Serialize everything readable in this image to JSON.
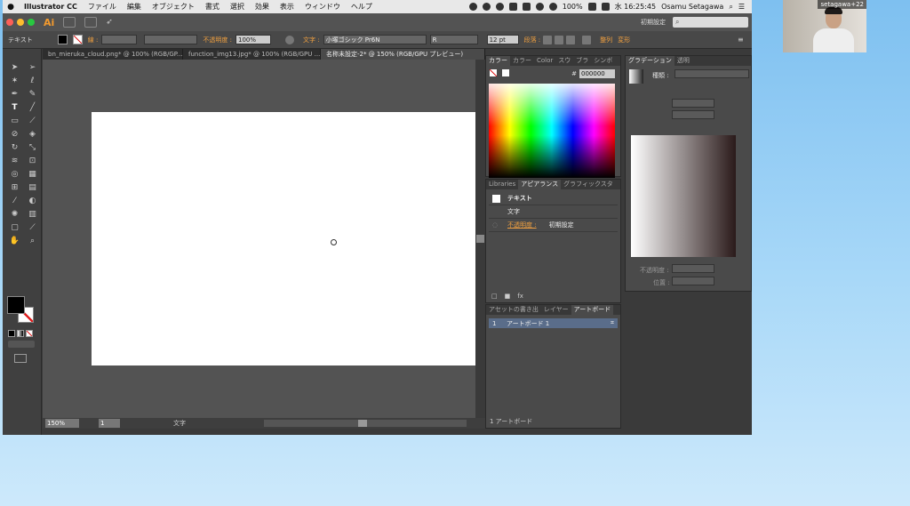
{
  "menubar": {
    "app_name": "Illustrator CC",
    "items": [
      "ファイル",
      "編集",
      "オブジェクト",
      "書式",
      "選択",
      "効果",
      "表示",
      "ウィンドウ",
      "ヘルプ"
    ],
    "battery": "100%",
    "clock": "水 16:25:45",
    "user": "Osamu Setagawa"
  },
  "appbar": {
    "logo": "Ai",
    "workspace": "初期設定",
    "search_placeholder": "⌕"
  },
  "control": {
    "tool_label": "テキスト",
    "stroke_label": "線 :",
    "opacity_label": "不透明度 :",
    "opacity_value": "100%",
    "font_label": "文字 :",
    "font_value": "小塚ゴシック Pr6N",
    "style_value": "R",
    "size_value": "12 pt",
    "para_label": "段落 :",
    "align_label": "整列",
    "transform_label": "変形"
  },
  "tabs": [
    {
      "label": "bn_mieruka_cloud.png* @ 100% (RGB/GP...",
      "active": false
    },
    {
      "label": "function_img13.jpg* @ 100% (RGB/GPU ...",
      "active": false
    },
    {
      "label": "名称未設定-2* @ 150% (RGB/GPU プレビュー)",
      "active": true
    }
  ],
  "status": {
    "zoom": "150%",
    "page": "1",
    "mode": "文字"
  },
  "color_panel": {
    "tabs": [
      "カラー",
      "カラー",
      "Color",
      "スウ",
      "ブラ",
      "シンボ"
    ],
    "hex_label": "#",
    "hex_value": "000000"
  },
  "appearance_panel": {
    "tabs": [
      "Libraries",
      "アピアランス",
      "グラフィックスタ"
    ],
    "title": "テキスト",
    "char_label": "文字",
    "opacity_label": "不透明度 :",
    "opacity_value": "初期設定"
  },
  "artboard_panel": {
    "tabs": [
      "アセットの書き出",
      "レイヤー",
      "アートボード"
    ],
    "row_index": "1",
    "row_name": "アートボード 1",
    "footer": "1 アートボード"
  },
  "gradient_panel": {
    "tabs": [
      "グラデーション",
      "透明"
    ],
    "type_label": "種類 :",
    "opacity_label": "不透明度 :",
    "position_label": "位置 :"
  },
  "webcam": {
    "name": "setagawa+22"
  }
}
